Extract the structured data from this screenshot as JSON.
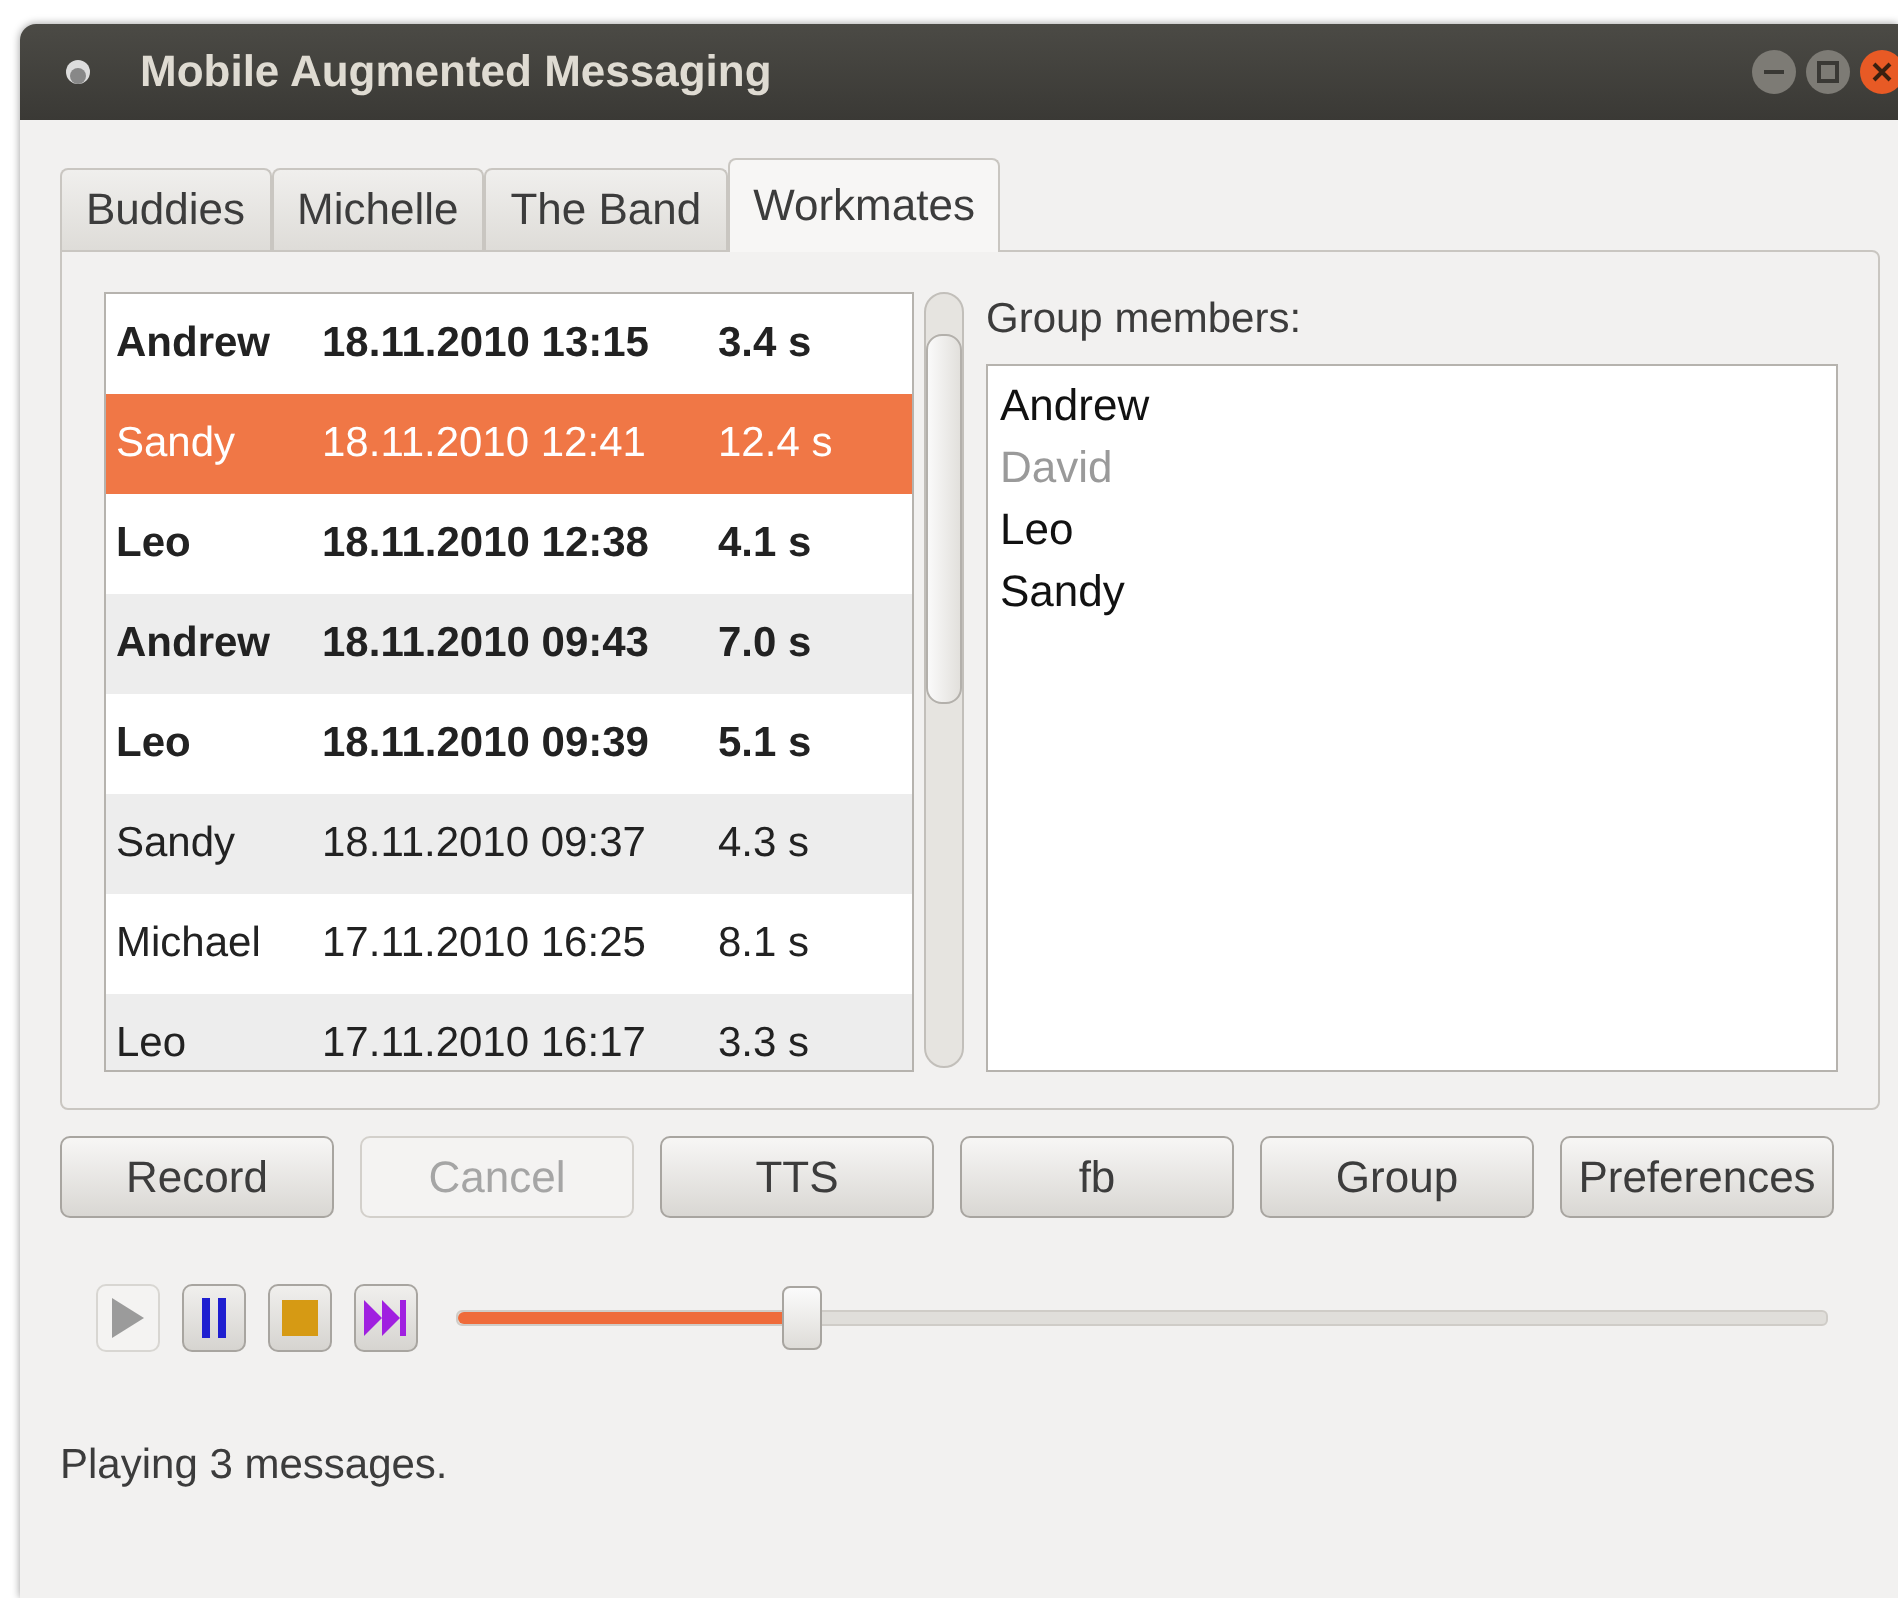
{
  "window": {
    "title": "Mobile Augmented Messaging"
  },
  "tabs": [
    {
      "label": "Buddies",
      "selected": false
    },
    {
      "label": "Michelle",
      "selected": false
    },
    {
      "label": "The Band",
      "selected": false
    },
    {
      "label": "Workmates",
      "selected": true
    }
  ],
  "messages": [
    {
      "sender": "Andrew",
      "time": "18.11.2010 13:15",
      "duration": "3.4 s",
      "unread": true,
      "selected": false
    },
    {
      "sender": "Sandy",
      "time": "18.11.2010 12:41",
      "duration": "12.4 s",
      "unread": false,
      "selected": true
    },
    {
      "sender": "Leo",
      "time": "18.11.2010 12:38",
      "duration": "4.1 s",
      "unread": true,
      "selected": false
    },
    {
      "sender": "Andrew",
      "time": "18.11.2010 09:43",
      "duration": "7.0 s",
      "unread": true,
      "selected": false
    },
    {
      "sender": "Leo",
      "time": "18.11.2010 09:39",
      "duration": "5.1 s",
      "unread": true,
      "selected": false
    },
    {
      "sender": "Sandy",
      "time": "18.11.2010 09:37",
      "duration": "4.3 s",
      "unread": false,
      "selected": false
    },
    {
      "sender": "Michael",
      "time": "17.11.2010 16:25",
      "duration": "8.1 s",
      "unread": false,
      "selected": false
    },
    {
      "sender": "Leo",
      "time": "17.11.2010 16:17",
      "duration": "3.3 s",
      "unread": false,
      "selected": false
    }
  ],
  "group": {
    "label": "Group members:",
    "members": [
      {
        "name": "Andrew",
        "disabled": false
      },
      {
        "name": "David",
        "disabled": true
      },
      {
        "name": "Leo",
        "disabled": false
      },
      {
        "name": "Sandy",
        "disabled": false
      }
    ]
  },
  "buttons": [
    {
      "label": "Record",
      "disabled": false
    },
    {
      "label": "Cancel",
      "disabled": true
    },
    {
      "label": "TTS",
      "disabled": false
    },
    {
      "label": "fb",
      "disabled": false
    },
    {
      "label": "Group",
      "disabled": false
    },
    {
      "label": "Preferences",
      "disabled": false
    }
  ],
  "player": {
    "controls": [
      {
        "kind": "play",
        "disabled": true
      },
      {
        "kind": "pause",
        "disabled": false
      },
      {
        "kind": "stop",
        "disabled": false
      },
      {
        "kind": "skip",
        "disabled": false
      }
    ],
    "level": 0.25
  },
  "status_bar": "Playing 3 messages."
}
